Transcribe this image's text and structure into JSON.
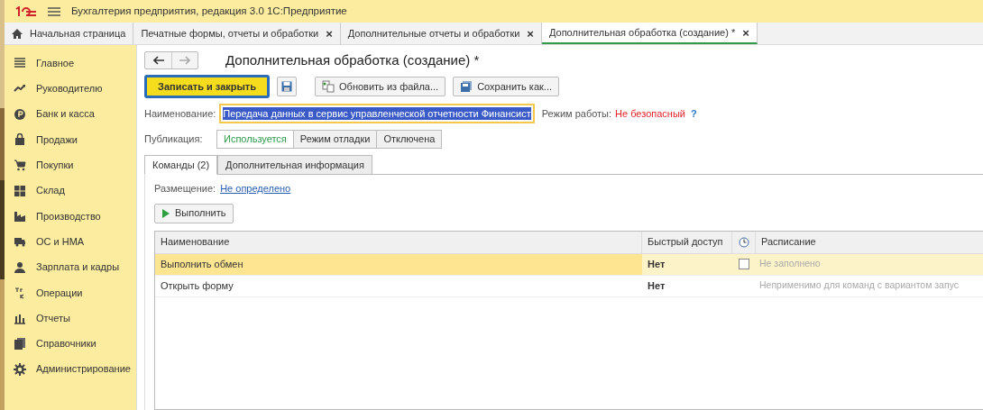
{
  "app_title": "Бухгалтерия предприятия, редакция 3.0 1С:Предприятие",
  "tabs": [
    {
      "label": "Начальная страница",
      "kind": "home",
      "selected": false
    },
    {
      "label": "Печатные формы, отчеты и обработки",
      "kind": "closable",
      "selected": false
    },
    {
      "label": "Дополнительные отчеты и обработки",
      "kind": "closable",
      "selected": false
    },
    {
      "label": "Дополнительная обработка (создание) *",
      "kind": "closable",
      "selected": true
    }
  ],
  "close_glyph": "×",
  "sidebar": {
    "items": [
      {
        "label": "Главное",
        "kind": "menu"
      },
      {
        "label": "Руководителю",
        "kind": "chart"
      },
      {
        "label": "Банк и касса",
        "kind": "coin"
      },
      {
        "label": "Продажи",
        "kind": "bag"
      },
      {
        "label": "Покупки",
        "kind": "cart"
      },
      {
        "label": "Склад",
        "kind": "grid"
      },
      {
        "label": "Производство",
        "kind": "factory"
      },
      {
        "label": "ОС и НМА",
        "kind": "truck"
      },
      {
        "label": "Зарплата и кадры",
        "kind": "person"
      },
      {
        "label": "Операции",
        "kind": "dtkt"
      },
      {
        "label": "Отчеты",
        "kind": "bars"
      },
      {
        "label": "Справочники",
        "kind": "books"
      },
      {
        "label": "Администрирование",
        "kind": "gear"
      }
    ]
  },
  "form": {
    "title": "Дополнительная обработка (создание) *",
    "buttons": [
      {
        "label": "Записать и закрыть",
        "kind": "primary"
      },
      {
        "kind": "save"
      },
      {
        "label": "Обновить из файла...",
        "kind": "update"
      },
      {
        "label": "Сохранить как...",
        "kind": "saveas"
      }
    ],
    "name_label": "Наименование:",
    "name_value": "Передача данных в сервис управленческой отчетности Финансист",
    "mode_label": "Режим работы:",
    "mode_value": "Не безопасный",
    "help": "?",
    "publication_label": "Публикация:",
    "publication": [
      {
        "label": "Используется",
        "selected": true
      },
      {
        "label": "Режим отладки",
        "selected": false
      },
      {
        "label": "Отключена",
        "selected": false
      }
    ],
    "tabs": [
      {
        "label": "Команды (2)",
        "selected": true
      },
      {
        "label": "Дополнительная информация",
        "selected": false
      }
    ],
    "placement_label": "Размещение:",
    "placement_value": "Не определено",
    "run_button": "Выполнить",
    "table": {
      "columns": [
        "Наименование",
        "Быстрый доступ",
        null,
        "Расписание"
      ],
      "rows": [
        {
          "name": "Выполнить обмен",
          "quick": "Нет",
          "checked": false,
          "schedule": "Не заполнено",
          "selected": true
        },
        {
          "name": "Открыть форму",
          "quick": "Нет",
          "schedule": "Неприменимо для команд с вариантом запус",
          "selected": false
        }
      ]
    }
  }
}
